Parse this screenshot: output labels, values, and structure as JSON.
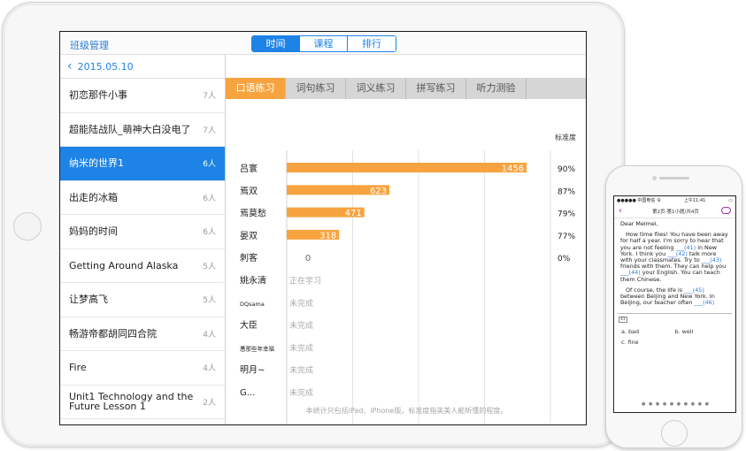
{
  "topbar": {
    "title": "班级管理",
    "segments": [
      "时间",
      "课程",
      "排行"
    ],
    "active_segment": 0
  },
  "sidebar": {
    "date": "2015.05.10",
    "items": [
      {
        "name": "初恋那件小事",
        "count": "7人"
      },
      {
        "name": "超能陆战队_萌神大白没电了",
        "count": "7人"
      },
      {
        "name": "纳米的世界1",
        "count": "6人"
      },
      {
        "name": "出走的冰箱",
        "count": "6人"
      },
      {
        "name": "妈妈的时间",
        "count": "6人"
      },
      {
        "name": "Getting Around Alaska",
        "count": "5人"
      },
      {
        "name": "让梦高飞",
        "count": "5人"
      },
      {
        "name": "畅游帝都胡同四合院",
        "count": "4人"
      },
      {
        "name": "Fire",
        "count": "4人"
      },
      {
        "name": "Unit1 Technology and the Future  Lesson 1",
        "count": "2人"
      }
    ],
    "active_index": 2
  },
  "tabs": [
    "口语练习",
    "词句练习",
    "词义练习",
    "拼写练习",
    "听力测验"
  ],
  "active_tab": 0,
  "accuracy_header": "标准度",
  "chart_data": {
    "type": "bar",
    "orientation": "horizontal",
    "xlim": [
      0,
      1600
    ],
    "grid": true,
    "bar_color": "#f7a440",
    "categories": [
      "吕寰",
      "焉双",
      "焉莫愁",
      "晏双",
      "刺客",
      "姚永清",
      "DQsama",
      "大臣",
      "愚那些年幸福",
      "明月~",
      "G..."
    ],
    "values": [
      1456,
      623,
      471,
      318,
      0,
      null,
      null,
      null,
      null,
      null,
      null
    ],
    "value_labels": [
      "1456",
      "623",
      "471",
      "318",
      "0",
      "",
      "",
      "",
      "",
      "",
      ""
    ],
    "status": [
      "",
      "",
      "",
      "",
      "",
      "正在学习",
      "未完成",
      "未完成",
      "未完成",
      "未完成",
      "未完成"
    ],
    "accuracy": [
      "90%",
      "87%",
      "79%",
      "77%",
      "0%",
      "",
      "",
      "",
      "",
      "",
      ""
    ]
  },
  "footer_hint": "本统计只包括iPad、iPhone版。标准度指英美人能听懂的程度。",
  "phone": {
    "status_left": "●●●●● 中国电信 令",
    "status_center": "上午11:41",
    "status_right": "▭",
    "page_title": "第2页-第1小题/共4页",
    "greeting": "Dear Meimei,",
    "para1": [
      {
        "t": "How time flies! You have been away for half a year. I'm sorry to hear that you are not feeling "
      },
      {
        "b": "___(41)"
      },
      {
        "t": " in New York. I think you "
      },
      {
        "b": "___(42)"
      },
      {
        "t": " talk more with your classmates. Try to "
      },
      {
        "b": "___(43)"
      },
      {
        "t": " friends with them. They can help you "
      },
      {
        "b": "___(44)"
      },
      {
        "t": " your English. You can teach them Chinese."
      }
    ],
    "para2": [
      {
        "t": "Of course, the life is "
      },
      {
        "b": "___(45)"
      },
      {
        "t": " between Beijing and New York. In Beijing, our teacher often "
      },
      {
        "b": "___(46)"
      }
    ],
    "question_num": "41",
    "options": [
      "a. bad",
      "b. well",
      "c. fine"
    ],
    "dots": "● ● ● ● ● ● ● ● ● ●"
  },
  "colors": {
    "accent": "#1e83e6",
    "bar": "#f7a440",
    "phone_accent": "#9b2fa8"
  }
}
